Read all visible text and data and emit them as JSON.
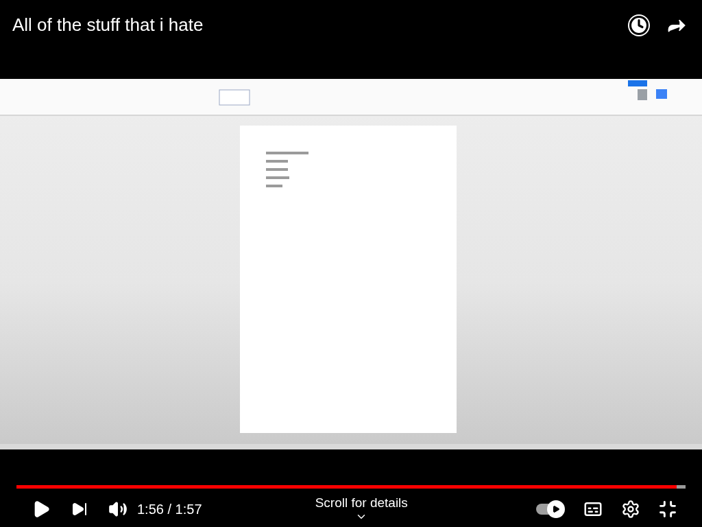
{
  "video": {
    "title": "All of the stuff that i hate",
    "kind": "picture"
  },
  "progress": {
    "level": 0.987
  },
  "controls": {
    "time": "1:56 / 1:57",
    "scroll_hint": "Scroll for details",
    "autoplay": {
      "on": true
    }
  }
}
